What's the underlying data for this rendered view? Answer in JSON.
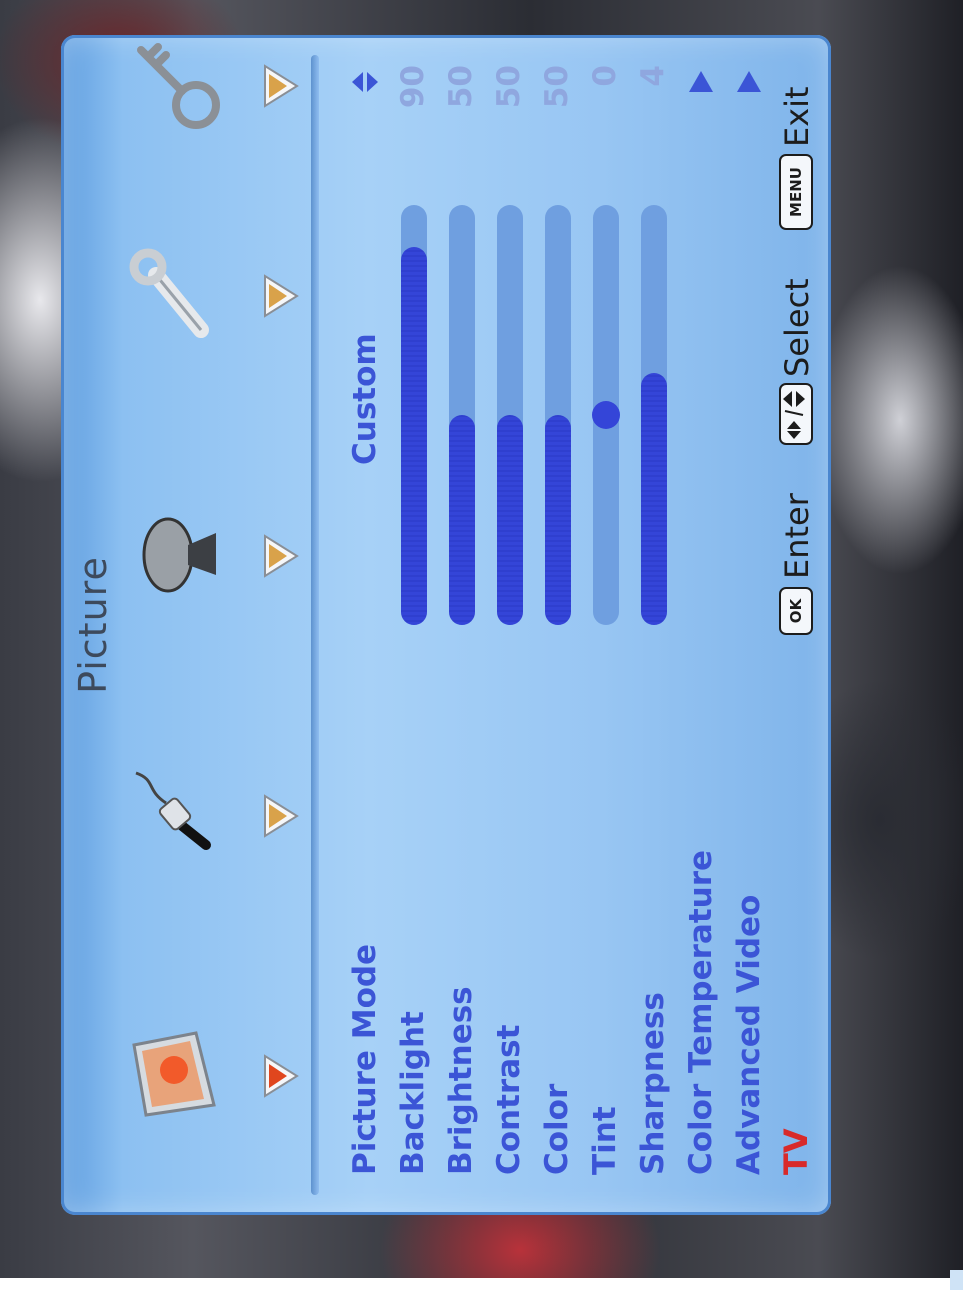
{
  "menu_title": "Picture",
  "tabs": [
    {
      "name": "picture",
      "icon": "picture-tab-icon"
    },
    {
      "name": "audio",
      "icon": "audio-plug-icon"
    },
    {
      "name": "channel",
      "icon": "satellite-dish-icon"
    },
    {
      "name": "setup",
      "icon": "wrench-icon"
    },
    {
      "name": "lock",
      "icon": "key-icon"
    }
  ],
  "rows": [
    {
      "label": "Picture Mode",
      "value": "Custom",
      "control": "selector"
    },
    {
      "label": "Backlight",
      "value": "90",
      "level": 0.9
    },
    {
      "label": "Brightness",
      "value": "50",
      "level": 0.5
    },
    {
      "label": "Contrast",
      "value": "50",
      "level": 0.5
    },
    {
      "label": "Color",
      "value": "50",
      "level": 0.5
    },
    {
      "label": "Tint",
      "value": "0",
      "level": 0.5,
      "control": "center-knob"
    },
    {
      "label": "Sharpness",
      "value": "4",
      "level": 0.6
    },
    {
      "label": "Color Temperature",
      "control": "submenu"
    },
    {
      "label": "Advanced Video",
      "control": "submenu"
    }
  ],
  "footer": {
    "source": "TV",
    "ok_key": "OK",
    "enter_label": "Enter",
    "select_label": "Select",
    "menu_key": "MENU",
    "exit_label": "Exit"
  },
  "colors": {
    "accent": "#3b55d6",
    "slider_fill": "#3445d8",
    "source_label": "#d82a2a",
    "panel": "#a7d1f7"
  }
}
